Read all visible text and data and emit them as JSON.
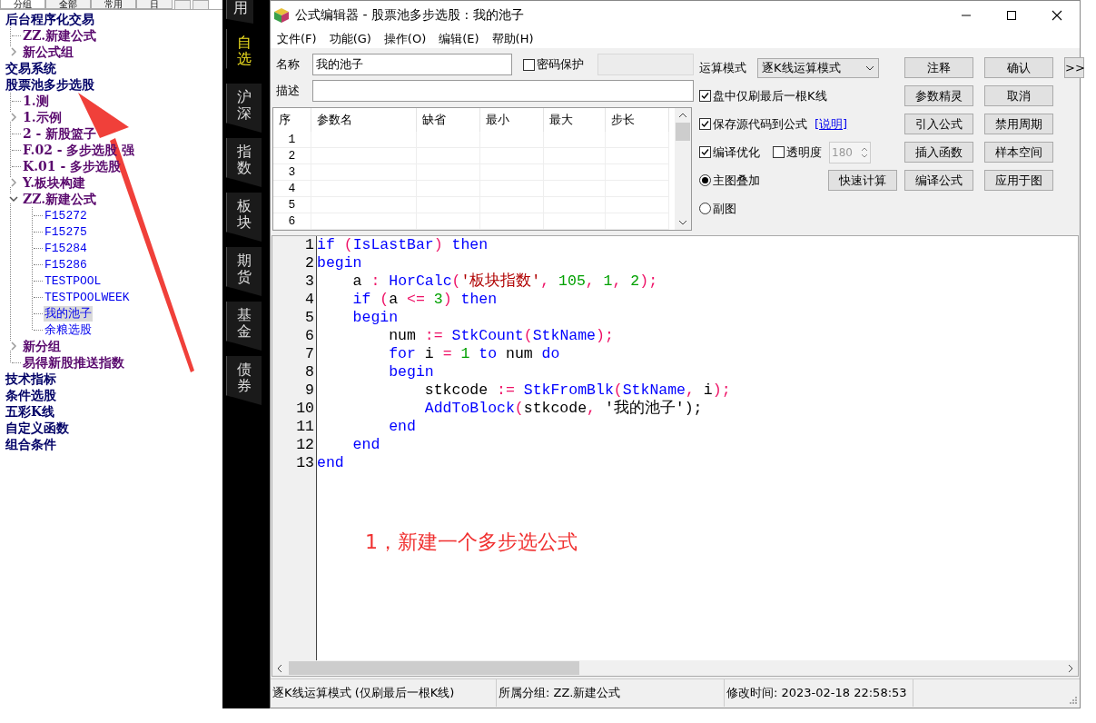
{
  "left_tabs": [
    {
      "label": "分组",
      "selected": true
    },
    {
      "label": "全部",
      "selected": false
    },
    {
      "label": "常用",
      "selected": false
    },
    {
      "label": "日",
      "selected": false
    }
  ],
  "tree": [
    {
      "label": "后台程序化交易",
      "kind": "category",
      "children": [
        {
          "label": "ZZ.新建公式",
          "kind": "item"
        },
        {
          "label": "新公式组",
          "kind": "folder",
          "expanded": false
        }
      ]
    },
    {
      "label": "交易系统",
      "kind": "category"
    },
    {
      "label": "股票池多步选股",
      "kind": "category",
      "children": [
        {
          "label": "1.测",
          "kind": "item"
        },
        {
          "label": "1.示例",
          "kind": "folder",
          "expanded": false
        },
        {
          "label": "2 - 新股篮子",
          "kind": "item"
        },
        {
          "label": "F.02 - 多步选股  强",
          "kind": "item"
        },
        {
          "label": "K.01 - 多步选股",
          "kind": "item"
        },
        {
          "label": "Y.板块构建",
          "kind": "folder",
          "expanded": false
        },
        {
          "label": "ZZ.新建公式",
          "kind": "folder",
          "expanded": true,
          "children": [
            {
              "label": "F15272",
              "kind": "formula",
              "selected": false
            },
            {
              "label": "F15275",
              "kind": "formula",
              "selected": false
            },
            {
              "label": "F15284",
              "kind": "formula",
              "selected": false
            },
            {
              "label": "F15286",
              "kind": "formula",
              "selected": false
            },
            {
              "label": "TESTPOOL",
              "kind": "formula",
              "selected": false
            },
            {
              "label": "TESTPOOLWEEK",
              "kind": "formula",
              "selected": false
            },
            {
              "label": "我的池子",
              "kind": "formula",
              "selected": true
            },
            {
              "label": "余粮选股",
              "kind": "formula",
              "selected": false
            }
          ]
        },
        {
          "label": "新分组",
          "kind": "folder",
          "expanded": false
        },
        {
          "label": "易得新股推送指数",
          "kind": "item"
        }
      ]
    },
    {
      "label": "技术指标",
      "kind": "category"
    },
    {
      "label": "条件选股",
      "kind": "category"
    },
    {
      "label": "五彩K线",
      "kind": "category"
    },
    {
      "label": "自定义函数",
      "kind": "category"
    },
    {
      "label": "组合条件",
      "kind": "category"
    }
  ],
  "side_tabs": [
    {
      "label": "用",
      "selected": false
    },
    {
      "label": "自选",
      "selected": true
    },
    {
      "label": "沪深",
      "selected": false
    },
    {
      "label": "指数",
      "selected": false
    },
    {
      "label": "板块",
      "selected": false
    },
    {
      "label": "期货",
      "selected": false
    },
    {
      "label": "基金",
      "selected": false
    },
    {
      "label": "债券",
      "selected": false
    }
  ],
  "window": {
    "title": "公式编辑器 - 股票池多步选股 : 我的池子"
  },
  "menu": [
    "文件(F)",
    "功能(G)",
    "操作(O)",
    "编辑(E)",
    "帮助(H)"
  ],
  "form": {
    "name_label": "名称",
    "name_value": "我的池子",
    "password": {
      "label": "密码保护",
      "checked": false
    },
    "desc_label": "描述",
    "mode_label": "运算模式",
    "mode_value": "逐K线运算模式",
    "options": [
      {
        "label": "盘中仅刷最后一根K线",
        "checked": true
      },
      {
        "label": "保存源代码到公式",
        "checked": true,
        "link": "[说明]"
      },
      {
        "label": "编译优化",
        "checked": true
      }
    ],
    "transparency": {
      "label": "透明度",
      "checked": false,
      "value": "180"
    },
    "radios": [
      {
        "label": "主图叠加",
        "selected": true
      },
      {
        "label": "副图",
        "selected": false
      }
    ],
    "quick_button": "快速计算",
    "buttons": [
      [
        "注释",
        "确认"
      ],
      [
        "参数精灵",
        "取消"
      ],
      [
        "引入公式",
        "禁用周期"
      ],
      [
        "插入函数",
        "样本空间"
      ],
      [
        "编译公式",
        "应用于图"
      ]
    ],
    "more_button": ">>"
  },
  "params": {
    "columns": [
      "序",
      "参数名",
      "缺省",
      "最小",
      "最大",
      "步长"
    ],
    "rows": [
      "1",
      "2",
      "3",
      "4",
      "5",
      "6"
    ]
  },
  "code": [
    {
      "number": "1",
      "tokens": [
        {
          "kind": "kw",
          "text": "if"
        },
        {
          "kind": "p",
          "text": " ("
        },
        {
          "kind": "fn",
          "text": "IsLastBar"
        },
        {
          "kind": "p",
          "text": ") "
        },
        {
          "kind": "kw",
          "text": "then"
        }
      ]
    },
    {
      "number": "2",
      "tokens": [
        {
          "kind": "kw",
          "text": "begin"
        }
      ]
    },
    {
      "number": "3",
      "tokens": [
        {
          "kind": "tx",
          "text": "    a "
        },
        {
          "kind": "p",
          "text": ": "
        },
        {
          "kind": "fn",
          "text": "HorCalc"
        },
        {
          "kind": "p",
          "text": "("
        },
        {
          "kind": "str",
          "text": "'板块指数'"
        },
        {
          "kind": "p",
          "text": ", "
        },
        {
          "kind": "num",
          "text": "105"
        },
        {
          "kind": "p",
          "text": ", "
        },
        {
          "kind": "num",
          "text": "1"
        },
        {
          "kind": "p",
          "text": ", "
        },
        {
          "kind": "num",
          "text": "2"
        },
        {
          "kind": "p",
          "text": ");"
        }
      ]
    },
    {
      "number": "4",
      "tokens": [
        {
          "kind": "kw",
          "text": "    if"
        },
        {
          "kind": "p",
          "text": " ("
        },
        {
          "kind": "tx",
          "text": "a "
        },
        {
          "kind": "p",
          "text": "<= "
        },
        {
          "kind": "num",
          "text": "3"
        },
        {
          "kind": "p",
          "text": ") "
        },
        {
          "kind": "kw",
          "text": "then"
        }
      ]
    },
    {
      "number": "5",
      "tokens": [
        {
          "kind": "kw",
          "text": "    begin"
        }
      ]
    },
    {
      "number": "6",
      "tokens": [
        {
          "kind": "tx",
          "text": "        num "
        },
        {
          "kind": "p",
          "text": ":= "
        },
        {
          "kind": "fn",
          "text": "StkCount"
        },
        {
          "kind": "p",
          "text": "("
        },
        {
          "kind": "fn",
          "text": "StkName"
        },
        {
          "kind": "p",
          "text": ");"
        }
      ]
    },
    {
      "number": "7",
      "tokens": [
        {
          "kind": "kw",
          "text": "        for"
        },
        {
          "kind": "tx",
          "text": " i "
        },
        {
          "kind": "p",
          "text": "= "
        },
        {
          "kind": "num",
          "text": "1"
        },
        {
          "kind": "kw",
          "text": " to"
        },
        {
          "kind": "tx",
          "text": " num "
        },
        {
          "kind": "kw",
          "text": "do"
        }
      ]
    },
    {
      "number": "8",
      "tokens": [
        {
          "kind": "kw",
          "text": "        begin"
        }
      ]
    },
    {
      "number": "9",
      "tokens": [
        {
          "kind": "tx",
          "text": "            stkcode "
        },
        {
          "kind": "p",
          "text": ":= "
        },
        {
          "kind": "fn",
          "text": "StkFromBlk"
        },
        {
          "kind": "p",
          "text": "("
        },
        {
          "kind": "fn",
          "text": "StkName"
        },
        {
          "kind": "p",
          "text": ", "
        },
        {
          "kind": "tx",
          "text": "i"
        },
        {
          "kind": "p",
          "text": ");"
        }
      ]
    },
    {
      "number": "10",
      "tokens": [
        {
          "kind": "fn",
          "text": "            AddToBlock"
        },
        {
          "kind": "p",
          "text": "("
        },
        {
          "kind": "tx",
          "text": "stkcode"
        },
        {
          "kind": "p",
          "text": ", "
        },
        {
          "kind": "tx",
          "text": "'我的池子');"
        }
      ]
    },
    {
      "number": "11",
      "tokens": [
        {
          "kind": "kw",
          "text": "        end"
        }
      ]
    },
    {
      "number": "12",
      "tokens": [
        {
          "kind": "kw",
          "text": "    end"
        }
      ]
    },
    {
      "number": "13",
      "tokens": [
        {
          "kind": "kw",
          "text": "end"
        }
      ]
    }
  ],
  "annotation": "1，新建一个多步选公式",
  "status_bar": [
    "逐K线运算模式 (仅刷最后一根K线)",
    "所属分组: ZZ.新建公式",
    "修改时间: 2023-02-18 22:58:53"
  ]
}
